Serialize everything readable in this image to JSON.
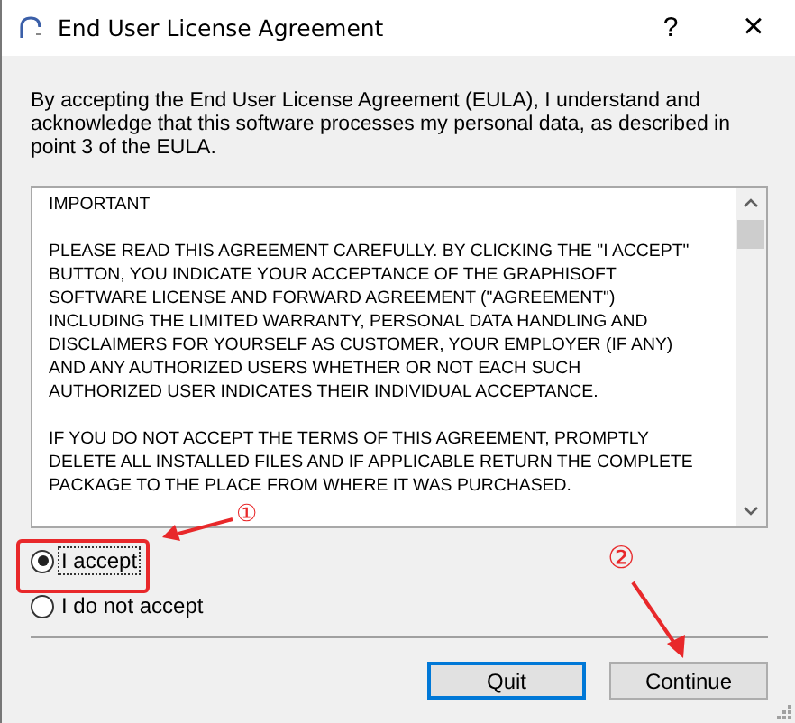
{
  "window": {
    "title": "End User License Agreement",
    "help": "?",
    "close": "×"
  },
  "intro": "By accepting the End User License Agreement (EULA), I understand and acknowledge that this software processes my personal data, as described in point 3 of the EULA.",
  "license_text": {
    "paragraphs": [
      {
        "lines": [
          "IMPORTANT"
        ]
      },
      {
        "lines": [
          "PLEASE READ THIS AGREEMENT CAREFULLY. BY CLICKING THE \"I ACCEPT\"",
          "BUTTON, YOU INDICATE YOUR ACCEPTANCE OF THE GRAPHISOFT",
          "SOFTWARE LICENSE AND FORWARD AGREEMENT (\"AGREEMENT\")",
          "INCLUDING THE LIMITED WARRANTY, PERSONAL DATA HANDLING AND",
          "DISCLAIMERS FOR YOURSELF AS CUSTOMER, YOUR EMPLOYER (IF ANY)",
          "AND ANY AUTHORIZED USERS WHETHER OR NOT EACH SUCH",
          "AUTHORIZED USER INDICATES THEIR INDIVIDUAL ACCEPTANCE."
        ]
      },
      {
        "lines": [
          "IF YOU DO NOT ACCEPT THE TERMS OF THIS AGREEMENT, PROMPTLY",
          "DELETE ALL INSTALLED FILES AND IF APPLICABLE RETURN THE COMPLETE",
          "PACKAGE TO THE PLACE FROM WHERE IT WAS PURCHASED."
        ]
      }
    ]
  },
  "choices": [
    {
      "label": "I accept",
      "selected": true
    },
    {
      "label": "I do not accept",
      "selected": false
    }
  ],
  "buttons": [
    {
      "label": "Quit",
      "default": true
    },
    {
      "label": "Continue",
      "default": false
    }
  ],
  "annotations": [
    {
      "label": "①"
    },
    {
      "label": "②"
    }
  ]
}
